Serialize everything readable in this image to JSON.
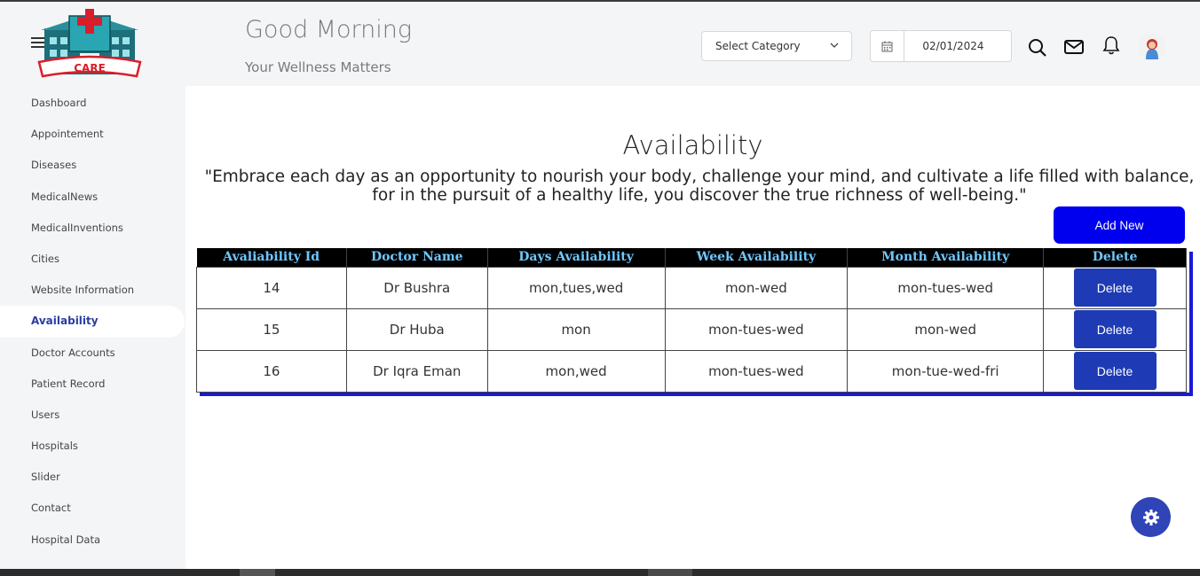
{
  "header": {
    "greeting": "Good Morning",
    "tagline": "Your Wellness Matters",
    "category_select": "Select Category",
    "date": "02/01/2024"
  },
  "logo": {
    "text": "CARE"
  },
  "sidebar": {
    "items": [
      {
        "label": "Dashboard"
      },
      {
        "label": "Appointement"
      },
      {
        "label": "Diseases"
      },
      {
        "label": "MedicalNews"
      },
      {
        "label": "MedicalInventions"
      },
      {
        "label": "Cities"
      },
      {
        "label": "Website Information"
      },
      {
        "label": "Availability",
        "active": true
      },
      {
        "label": "Doctor Accounts"
      },
      {
        "label": "Patient Record"
      },
      {
        "label": "Users"
      },
      {
        "label": "Hospitals"
      },
      {
        "label": "Slider"
      },
      {
        "label": "Contact"
      },
      {
        "label": "Hospital Data"
      }
    ]
  },
  "main": {
    "title": "Availability",
    "quote": "\"Embrace each day as an opportunity to nourish your body, challenge your mind, and cultivate a life filled with balance, for in the pursuit of a healthy life, you discover the true richness of well-being.\"",
    "add_button": "Add New",
    "table": {
      "headers": [
        "Avaliability Id",
        "Doctor Name",
        "Days Availability",
        "Week Availability",
        "Month Availability",
        "Delete"
      ],
      "rows": [
        {
          "id": "14",
          "doctor": "Dr Bushra",
          "days": "mon,tues,wed",
          "week": "mon-wed",
          "month": "mon-tues-wed",
          "action": "Delete"
        },
        {
          "id": "15",
          "doctor": "Dr Huba",
          "days": "mon",
          "week": "mon-tues-wed",
          "month": "mon-wed",
          "action": "Delete"
        },
        {
          "id": "16",
          "doctor": "Dr Iqra Eman",
          "days": "mon,wed",
          "week": "mon-tues-wed",
          "month": "mon-tue-wed-fri",
          "action": "Delete"
        }
      ]
    }
  },
  "icons": {
    "menu": "hamburger-menu-icon",
    "calendar": "calendar-icon",
    "search": "search-icon",
    "mail": "mail-icon",
    "notifications": "bell-icon",
    "settings": "gear-icon"
  },
  "colors": {
    "accent": "#2b3da3",
    "add_button": "#0000ee",
    "delete_button": "#1e3bb5",
    "table_header_bg": "#000000",
    "table_header_text": "#6fc8ff",
    "fab": "#2f44b6"
  }
}
